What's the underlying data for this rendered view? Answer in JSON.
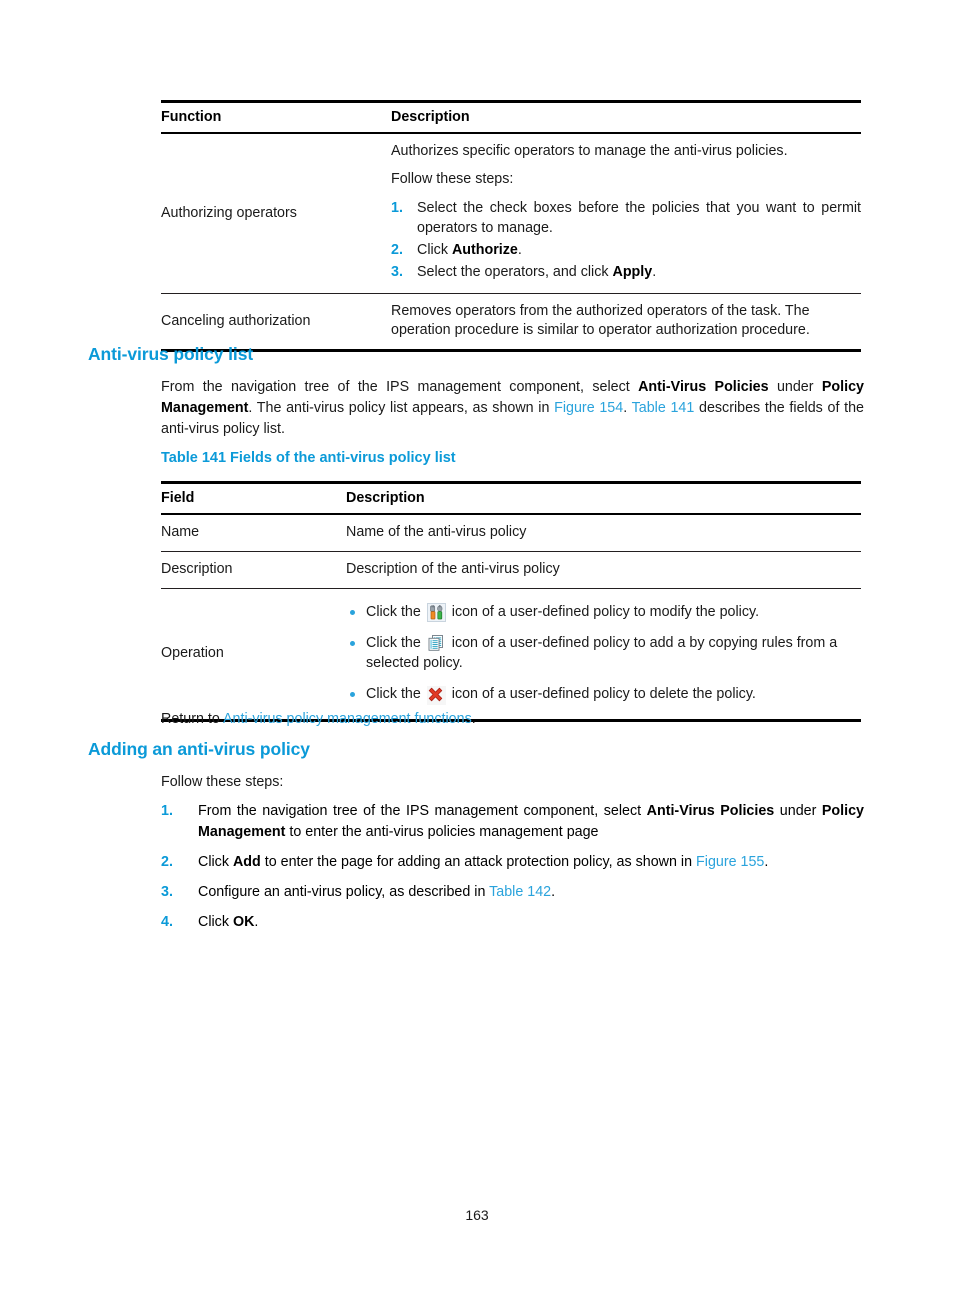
{
  "page": {
    "number": "163",
    "accent_blue": "#0b9ad8",
    "link_blue": "#2aa3dc"
  },
  "table_functions": {
    "headers": [
      "Function",
      "Description"
    ],
    "rows": [
      {
        "function": "Authorizing operators",
        "intro": "Authorizes specific operators to manage the anti-virus policies.",
        "follow_label": "Follow these steps:",
        "steps": [
          {
            "pre": "Select the check boxes before the policies that you want to permit operators to manage.",
            "bold": "",
            "post": ""
          },
          {
            "pre": "Click ",
            "bold": "Authorize",
            "post": "."
          },
          {
            "pre": "Select the operators, and click ",
            "bold": "Apply",
            "post": "."
          }
        ]
      },
      {
        "function": "Canceling authorization",
        "description": "Removes operators from the authorized operators of the task. The operation procedure is similar to operator authorization procedure."
      }
    ]
  },
  "section_policy_list": {
    "heading": "Anti-virus policy list",
    "paragraph": {
      "p1": "From the navigation tree of the IPS management component, select ",
      "b1": "Anti-Virus Policies",
      "p2": " under ",
      "b2": "Policy Management",
      "p3": ". The anti-virus policy list appears, as shown in ",
      "link1": "Figure 154",
      "p4": ". ",
      "link2": "Table 141",
      "p5": " describes the fields of the anti-virus policy list."
    }
  },
  "table_fields": {
    "caption": "Table 141 Fields of the anti-virus policy list",
    "headers": [
      "Field",
      "Description"
    ],
    "rows": [
      {
        "field": "Name",
        "description": "Name of the anti-virus policy"
      },
      {
        "field": "Description",
        "description": "Description of the anti-virus policy"
      }
    ],
    "operation_row": {
      "field": "Operation",
      "bullets": [
        {
          "pre": "Click the ",
          "icon": "modify-icon",
          "post": " icon of a user-defined policy to modify the policy."
        },
        {
          "pre": "Click the ",
          "icon": "copy-icon",
          "post": " icon of a user-defined policy to add a by copying rules from a selected policy."
        },
        {
          "pre": "Click the ",
          "icon": "delete-icon",
          "post": " icon of a user-defined policy to delete the policy."
        }
      ]
    }
  },
  "return_to": {
    "prefix": "Return to ",
    "link": "Anti-virus policy management functions",
    "suffix": "."
  },
  "section_adding": {
    "heading": "Adding an anti-virus policy",
    "intro": "Follow these steps:",
    "steps": [
      {
        "p1": "From the navigation tree of the IPS management component, select ",
        "b1": "Anti-Virus Policies",
        "p2": " under ",
        "b2": "Policy Management",
        "p3": " to enter the anti-virus policies management page",
        "link": "",
        "p4": ""
      },
      {
        "p1": "Click ",
        "b1": "Add",
        "p2": " to enter the page for adding an attack protection policy, as shown in ",
        "b2": "",
        "p3": "",
        "link": "Figure 155",
        "p4": "."
      },
      {
        "p1": "Configure an anti-virus policy, as described in ",
        "b1": "",
        "p2": "",
        "b2": "",
        "p3": "",
        "link": "Table 142",
        "p4": "."
      },
      {
        "p1": "Click ",
        "b1": "OK",
        "p2": ".",
        "b2": "",
        "p3": "",
        "link": "",
        "p4": ""
      }
    ]
  }
}
